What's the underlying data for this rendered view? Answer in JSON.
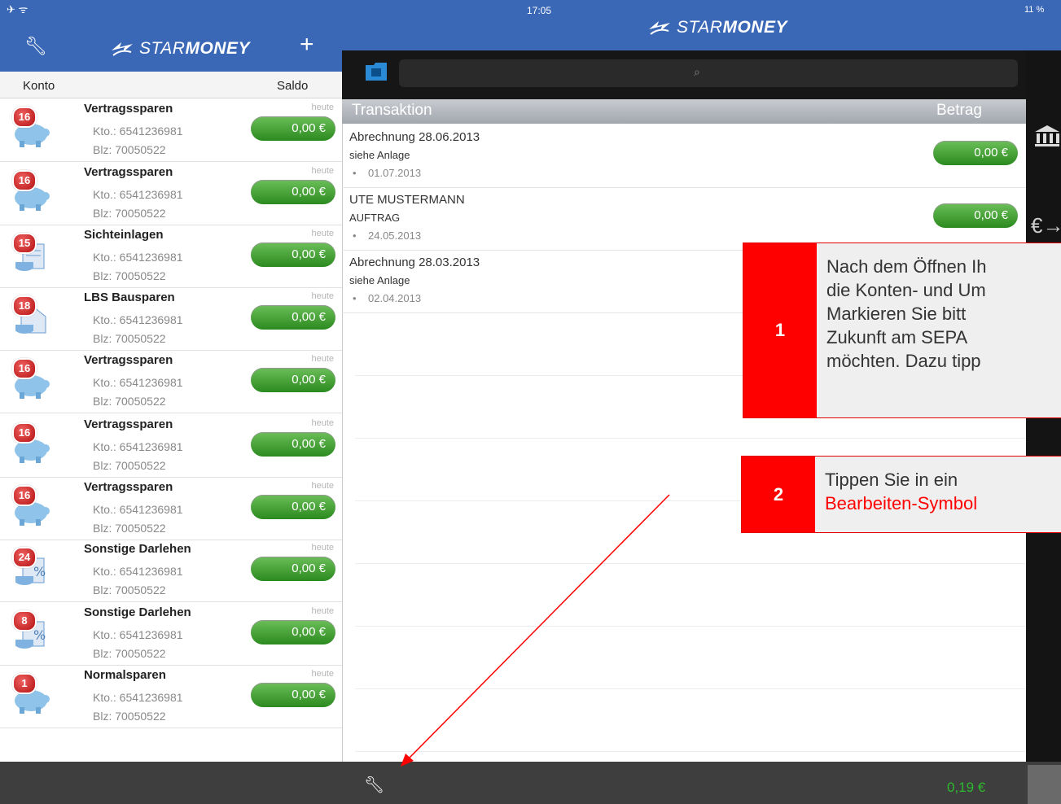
{
  "status_bar": {
    "time": "17:05",
    "battery": "11 %"
  },
  "brand": {
    "name_prefix": "STAR",
    "name_suffix": "MONEY"
  },
  "left_pane": {
    "col_account": "Konto",
    "col_balance": "Saldo",
    "accounts": [
      {
        "name": "Vertragssparen",
        "badge": "16",
        "kto": "Kto.: 6541236981",
        "blz": "Blz: 70050522",
        "date": "heute",
        "balance": "0,00 €",
        "icon": "piggy-bank-icon"
      },
      {
        "name": "Vertragssparen",
        "badge": "16",
        "kto": "Kto.: 6541236981",
        "blz": "Blz: 70050522",
        "date": "heute",
        "balance": "0,00 €",
        "icon": "piggy-bank-icon"
      },
      {
        "name": "Sichteinlagen",
        "badge": "15",
        "kto": "Kto.: 6541236981",
        "blz": "Blz: 70050522",
        "date": "heute",
        "balance": "0,00 €",
        "icon": "document-coins-icon"
      },
      {
        "name": "LBS Bausparen",
        "badge": "18",
        "kto": "Kto.: 6541236981",
        "blz": "Blz: 70050522",
        "date": "heute",
        "balance": "0,00 €",
        "icon": "house-coins-icon"
      },
      {
        "name": "Vertragssparen",
        "badge": "16",
        "kto": "Kto.: 6541236981",
        "blz": "Blz: 70050522",
        "date": "heute",
        "balance": "0,00 €",
        "icon": "piggy-bank-icon"
      },
      {
        "name": "Vertragssparen",
        "badge": "16",
        "kto": "Kto.: 6541236981",
        "blz": "Blz: 70050522",
        "date": "heute",
        "balance": "0,00 €",
        "icon": "piggy-bank-icon"
      },
      {
        "name": "Vertragssparen",
        "badge": "16",
        "kto": "Kto.: 6541236981",
        "blz": "Blz: 70050522",
        "date": "heute",
        "balance": "0,00 €",
        "icon": "piggy-bank-icon"
      },
      {
        "name": "Sonstige Darlehen",
        "badge": "24",
        "kto": "Kto.: 6541236981",
        "blz": "Blz: 70050522",
        "date": "heute",
        "balance": "0,00 €",
        "icon": "percent-document-icon"
      },
      {
        "name": "Sonstige Darlehen",
        "badge": "8",
        "kto": "Kto.: 6541236981",
        "blz": "Blz: 70050522",
        "date": "heute",
        "balance": "0,00 €",
        "icon": "percent-document-icon"
      },
      {
        "name": "Normalsparen",
        "badge": "1",
        "kto": "Kto.: 6541236981",
        "blz": "Blz: 70050522",
        "date": "heute",
        "balance": "0,00 €",
        "icon": "piggy-bank-icon"
      }
    ]
  },
  "right_pane": {
    "col_transaction": "Transaktion",
    "col_amount": "Betrag",
    "transactions": [
      {
        "title": "Abrechnung 28.06.2013",
        "sub": "siehe Anlage",
        "date": "01.07.2013",
        "amount": "0,00 €"
      },
      {
        "title": "UTE MUSTERMANN",
        "sub": "AUFTRAG",
        "date": "24.05.2013",
        "amount": "0,00 €"
      },
      {
        "title": "Abrechnung 28.03.2013",
        "sub": "siehe Anlage",
        "date": "02.04.2013",
        "amount": ""
      }
    ],
    "total": "0,19 €"
  },
  "callouts": [
    {
      "number": "1",
      "lines": [
        "Nach dem Öffnen Ih",
        "die Konten- und Um",
        "Markieren Sie bitt",
        "Zukunft am SEPA",
        "möchten. Dazu tipp"
      ]
    },
    {
      "number": "2",
      "line1": "Tippen Sie in ein",
      "line2": "Bearbeiten-Symbol"
    }
  ],
  "colors": {
    "brand_blue": "#3b68b6",
    "callout_red": "#ff0000",
    "balance_green": "#3a9a2b",
    "dark_bar": "#3e3e3e"
  }
}
